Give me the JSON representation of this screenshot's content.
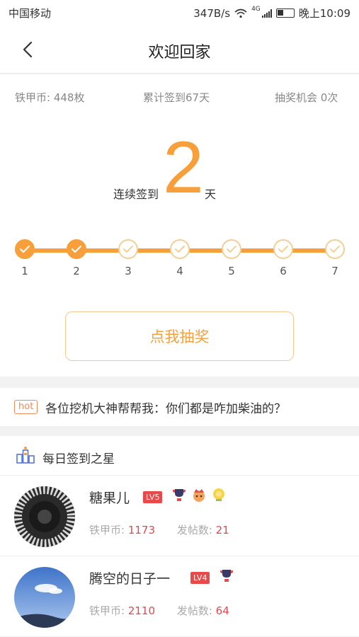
{
  "status_bar": {
    "carrier": "中国移动",
    "speed": "347B/s",
    "network": "4G",
    "time": "晚上10:09"
  },
  "nav": {
    "title": "欢迎回家"
  },
  "stats": {
    "coins": "铁甲币: 448枚",
    "total_checkin": "累计签到67天",
    "lottery_chances": "抽奖机会 0次"
  },
  "streak": {
    "prefix": "连续签到",
    "days": "2",
    "suffix": "天"
  },
  "days": [
    {
      "label": "1",
      "checked": true
    },
    {
      "label": "2",
      "checked": true
    },
    {
      "label": "3",
      "checked": false
    },
    {
      "label": "4",
      "checked": false
    },
    {
      "label": "5",
      "checked": false
    },
    {
      "label": "6",
      "checked": false
    },
    {
      "label": "7",
      "checked": false
    }
  ],
  "lottery_button": "点我抽奖",
  "hot": {
    "tag": "hot",
    "text": "各位挖机大神帮帮我：你们都是咋加柴油的？"
  },
  "stars": {
    "title": "每日签到之星",
    "coin_label": "铁甲币:",
    "posts_label": "发帖数:",
    "users": [
      {
        "name": "糖果儿",
        "level": "LV5",
        "coins": "1173",
        "posts": "21",
        "medals": [
          "trophy-medal-icon",
          "crown-medal-icon",
          "gold-medal-icon"
        ]
      },
      {
        "name": "腾空的日子一",
        "level": "LV4",
        "coins": "2110",
        "posts": "64",
        "medals": [
          "trophy-medal-icon"
        ]
      }
    ]
  },
  "colors": {
    "accent": "#f7a03b",
    "badge": "#e84a4a",
    "stat_value": "#e0494f"
  }
}
